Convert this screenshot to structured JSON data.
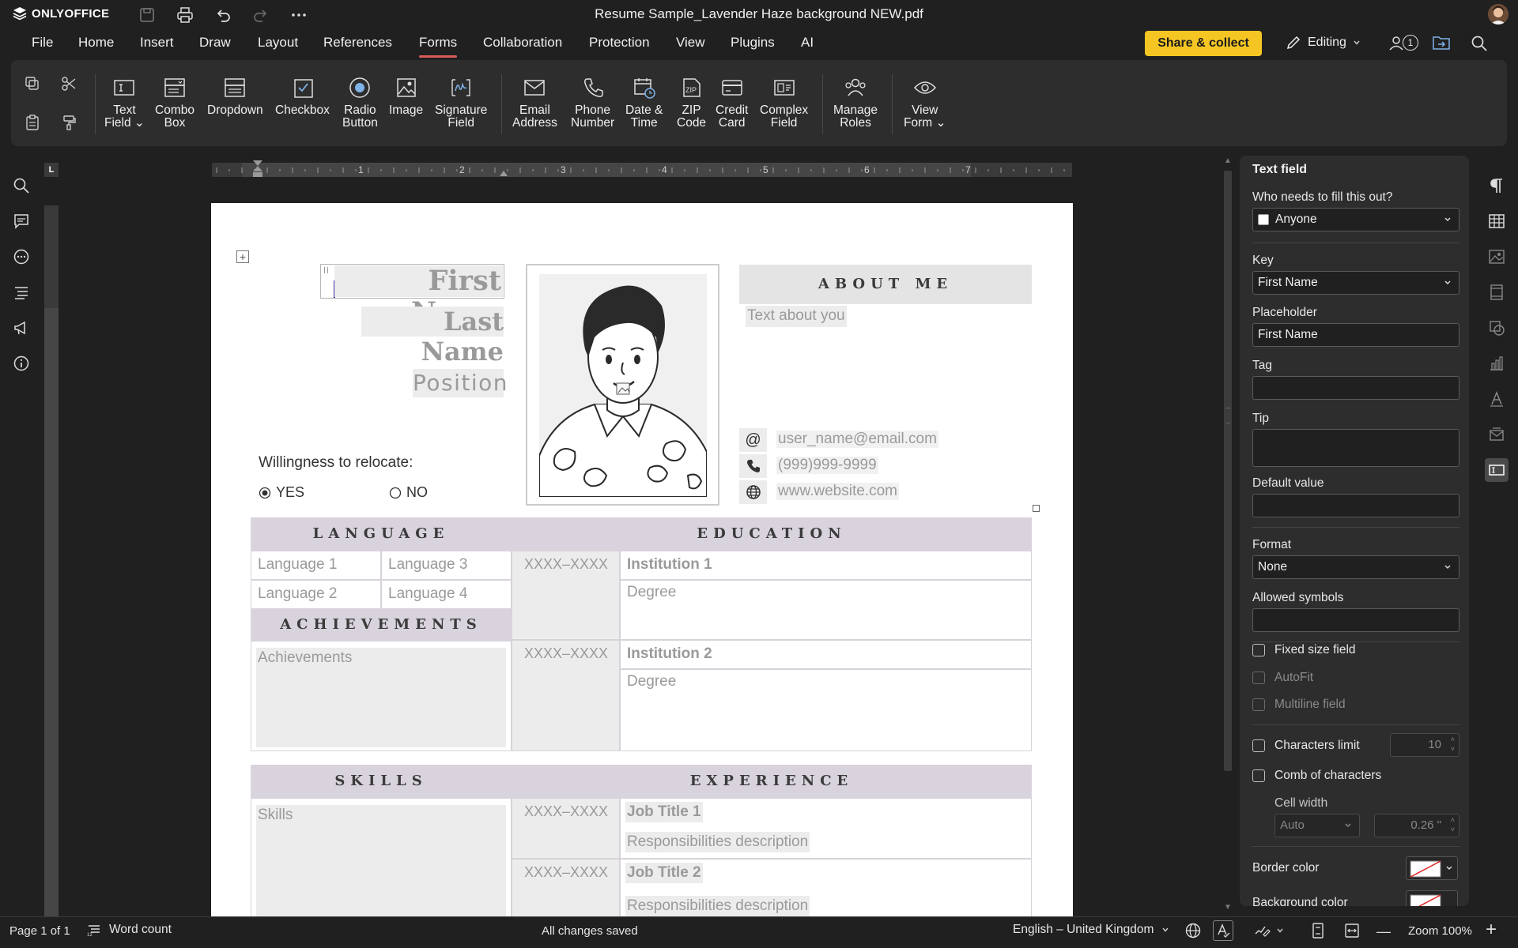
{
  "app": {
    "logo": "ONLYOFFICE",
    "doc_title": "Resume Sample_Lavender Haze background NEW.pdf"
  },
  "menu": [
    "File",
    "Home",
    "Insert",
    "Draw",
    "Layout",
    "References",
    "Forms",
    "Collaboration",
    "Protection",
    "View",
    "Plugins",
    "AI"
  ],
  "menu_active": "Forms",
  "header": {
    "share_label": "Share & collect",
    "editing_label": "Editing",
    "users_count": "1"
  },
  "toolbar": {
    "text_field": [
      "Text",
      "Field"
    ],
    "combo_box": [
      "Combo",
      "Box"
    ],
    "dropdown": "Dropdown",
    "checkbox": "Checkbox",
    "radio_button": [
      "Radio",
      "Button"
    ],
    "image": "Image",
    "signature_field": [
      "Signature",
      "Field"
    ],
    "email_address": [
      "Email",
      "Address"
    ],
    "phone_number": [
      "Phone",
      "Number"
    ],
    "date_time": [
      "Date &",
      "Time"
    ],
    "zip_code": [
      "ZIP",
      "Code"
    ],
    "credit_card": [
      "Credit",
      "Card"
    ],
    "complex_field": [
      "Complex",
      "Field"
    ],
    "manage_roles": [
      "Manage",
      "Roles"
    ],
    "view_form": [
      "View",
      "Form"
    ]
  },
  "ruler": {
    "numbers": [
      "1",
      "2",
      "3",
      "4",
      "5",
      "6",
      "7"
    ]
  },
  "document": {
    "first_name": "First Name",
    "last_name": "Last Name",
    "position": "Position",
    "about_me_title": "ABOUT ME",
    "about_text": "Text about you",
    "email": "user_name@email.com",
    "phone": "(999)999-9999",
    "website": "www.website.com",
    "relocate_label": "Willingness to relocate:",
    "relocate_yes": "YES",
    "relocate_no": "NO",
    "relocate_selected": "YES",
    "language_title": "LANGUAGE",
    "languages": [
      "Language 1",
      "Language 3",
      "Language 2",
      "Language 4"
    ],
    "education_title": "EDUCATION",
    "education": [
      {
        "years": "XXXX–XXXX",
        "institution": "Institution 1",
        "degree": "Degree"
      },
      {
        "years": "XXXX–XXXX",
        "institution": "Institution 2",
        "degree": "Degree"
      }
    ],
    "achievements_title": "ACHIEVEMENTS",
    "achievements": "Achievements",
    "skills_title": "SKILLS",
    "skills": "Skills",
    "experience_title": "EXPERIENCE",
    "experience": [
      {
        "years": "XXXX–XXXX",
        "title": "Job Title 1",
        "desc": "Responsibilities description"
      },
      {
        "years": "XXXX–XXXX",
        "title": "Job Title 2",
        "desc": "Responsibilities description"
      }
    ]
  },
  "panel": {
    "title": "Text field",
    "who_label": "Who needs to fill this out?",
    "who_value": "Anyone",
    "key_label": "Key",
    "key_value": "First Name",
    "placeholder_label": "Placeholder",
    "placeholder_value": "First Name",
    "tag_label": "Tag",
    "tag_value": "",
    "tip_label": "Tip",
    "tip_value": "",
    "default_label": "Default value",
    "default_value": "",
    "format_label": "Format",
    "format_value": "None",
    "allowed_label": "Allowed symbols",
    "allowed_value": "",
    "fixed_size": "Fixed size field",
    "autofit": "AutoFit",
    "multiline": "Multiline field",
    "chars_limit": "Characters limit",
    "chars_limit_value": "10",
    "comb": "Comb of characters",
    "cell_width_label": "Cell width",
    "cell_width_mode": "Auto",
    "cell_width_value": "0.26 \"",
    "border_color": "Border color",
    "background_color": "Background color"
  },
  "status": {
    "page": "Page 1 of 1",
    "word_count": "Word count",
    "saved": "All changes saved",
    "language": "English – United Kingdom",
    "zoom": "Zoom 100%"
  },
  "colors": {
    "accent_yellow": "#f5c623",
    "active_tab_underline": "#d95c5c",
    "section_header": "#d9d3dd"
  }
}
